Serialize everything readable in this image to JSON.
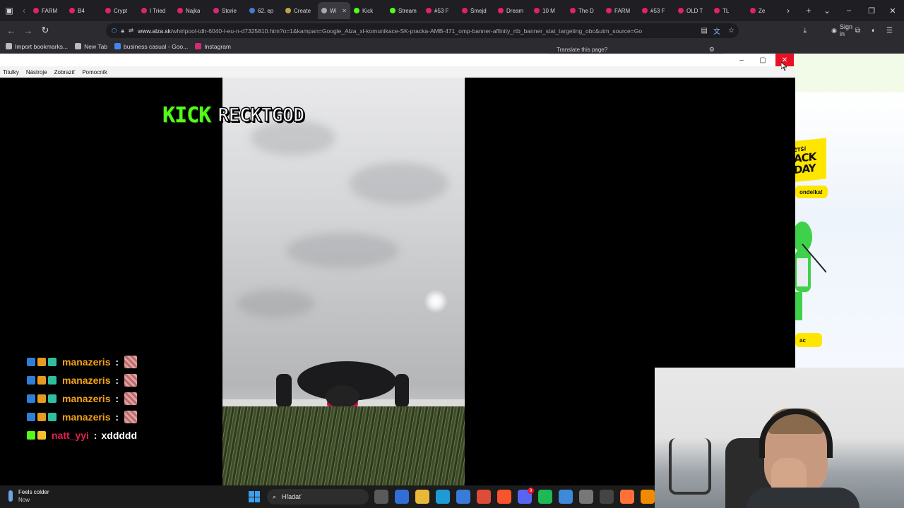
{
  "browser": {
    "tabs": [
      {
        "label": "FARM",
        "color": "#e0245e"
      },
      {
        "label": "B4",
        "color": "#e0245e"
      },
      {
        "label": "Crypt",
        "color": "#e0245e"
      },
      {
        "label": "I Tried",
        "color": "#e0245e"
      },
      {
        "label": "Najka",
        "color": "#e0245e"
      },
      {
        "label": "Storie",
        "color": "#d62976"
      },
      {
        "label": "62. ep",
        "color": "#4a7bd0"
      },
      {
        "label": "Create",
        "color": "#c2a24a"
      },
      {
        "label": "Wi",
        "color": "#aaaaaa",
        "active": true
      },
      {
        "label": "Kick",
        "color": "#53fc18"
      },
      {
        "label": "Stream",
        "color": "#53fc18"
      },
      {
        "label": "#53 F",
        "color": "#e0245e"
      },
      {
        "label": "Šmejd",
        "color": "#e0245e"
      },
      {
        "label": "Dream",
        "color": "#e0245e"
      },
      {
        "label": "10 M",
        "color": "#e0245e"
      },
      {
        "label": "The D",
        "color": "#e0245e"
      },
      {
        "label": "FARM",
        "color": "#e0245e"
      },
      {
        "label": "#53 F",
        "color": "#e0245e"
      },
      {
        "label": "OLD T",
        "color": "#e0245e"
      },
      {
        "label": "TL",
        "color": "#e0245e"
      },
      {
        "label": "Ze",
        "color": "#e0245e"
      }
    ],
    "url_domain": "www.alza.sk",
    "url_rest": "/whirlpool-tdlr-6040-l-eu-n-d7325810.htm?o=1&kampan=Google_Alza_xl-komunikace-SK-pracka-AMB-471_omp-banner-affinity_rtb_banner_stat_targeting_obc&utm_source=Go",
    "signin_label": "Sign in",
    "bookmarks": [
      {
        "label": "Import bookmarks...",
        "color": "#bbbbbb"
      },
      {
        "label": "New Tab",
        "color": "#bbbbbb"
      },
      {
        "label": "business casual - Goo...",
        "color": "#4285f4"
      },
      {
        "label": "Instagram",
        "color": "#d62976"
      }
    ],
    "translate_prompt": "Translate this page?"
  },
  "webpage": {
    "badge_line1": "ĚTŠÍ",
    "badge_line2": "ACK",
    "badge_line3": "DAY",
    "pill1": "ondelka!",
    "pill2": "ac"
  },
  "player": {
    "menu": [
      "Titulky",
      "Nástroje",
      "Zobraziť",
      "Pomocník"
    ],
    "kick_logo": "KICK",
    "channel_name": "RECKTGOD"
  },
  "chat": [
    {
      "user": "manazeris",
      "msg": "",
      "emote": true,
      "badges": [
        "#2f7fd8",
        "#e69a1f",
        "#2fbf9f"
      ],
      "user_color": "#f6a41a"
    },
    {
      "user": "manazeris",
      "msg": "",
      "emote": true,
      "badges": [
        "#2f7fd8",
        "#e69a1f",
        "#2fbf9f"
      ],
      "user_color": "#f6a41a"
    },
    {
      "user": "manazeris",
      "msg": "",
      "emote": true,
      "badges": [
        "#2f7fd8",
        "#e69a1f",
        "#2fbf9f"
      ],
      "user_color": "#f6a41a"
    },
    {
      "user": "manazeris",
      "msg": "",
      "emote": true,
      "badges": [
        "#2f7fd8",
        "#e69a1f",
        "#2fbf9f"
      ],
      "user_color": "#f6a41a"
    },
    {
      "user": "natt_yyi",
      "msg": "xddddd",
      "emote": false,
      "badges": [
        "#53fc18",
        "#f2c12e"
      ],
      "user_color": "#e1204f"
    }
  ],
  "taskbar": {
    "weather_title": "Feels colder",
    "weather_sub": "Now",
    "search_placeholder": "Hľadať",
    "icons": [
      {
        "name": "task-view-icon",
        "color": "#5a5a5a"
      },
      {
        "name": "store-icon",
        "color": "#2f6fd6"
      },
      {
        "name": "file-explorer-icon",
        "color": "#e8b83a"
      },
      {
        "name": "edge-icon",
        "color": "#1e9bd7"
      },
      {
        "name": "photos-icon",
        "color": "#3a7ad8"
      },
      {
        "name": "chrome-icon",
        "color": "#dd4b39"
      },
      {
        "name": "brave-icon",
        "color": "#fb542b"
      },
      {
        "name": "discord-icon",
        "color": "#5865f2",
        "notif": "9"
      },
      {
        "name": "spotify-icon",
        "color": "#1db954"
      },
      {
        "name": "notepad-icon",
        "color": "#3c8ad8"
      },
      {
        "name": "settings-icon",
        "color": "#777777"
      },
      {
        "name": "obs-icon",
        "color": "#444444"
      },
      {
        "name": "firefox-icon",
        "color": "#ff7139"
      },
      {
        "name": "vlc-icon",
        "color": "#f08a00"
      }
    ]
  }
}
